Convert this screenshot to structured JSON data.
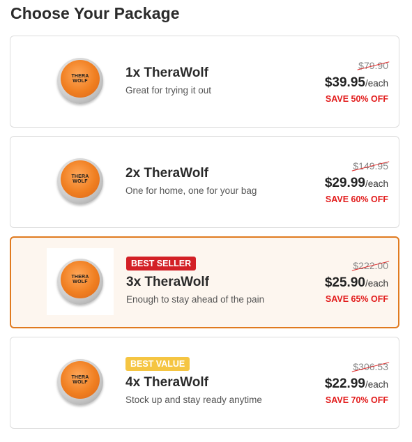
{
  "page": {
    "title": "Choose Your Package"
  },
  "product_image": {
    "brand_line1": "THERA",
    "brand_line2": "WOLF"
  },
  "colors": {
    "accent_border": "#e07a1f",
    "selected_bg": "#fdf6ef",
    "save_red": "#e21b1b",
    "badge_red": "#d32026",
    "badge_yellow": "#f5c542"
  },
  "packages": [
    {
      "name": "1x TheraWolf",
      "description": "Great for trying it out",
      "badge": "",
      "original_price": "$79.90",
      "price": "$39.95",
      "unit": "/each",
      "savings": "SAVE 50% OFF",
      "selected": false
    },
    {
      "name": "2x TheraWolf",
      "description": "One for home, one for your bag",
      "badge": "",
      "original_price": "$149.95",
      "price": "$29.99",
      "unit": "/each",
      "savings": "SAVE 60% OFF",
      "selected": false
    },
    {
      "name": "3x TheraWolf",
      "description": "Enough to stay ahead of the pain",
      "badge": "BEST SELLER",
      "original_price": "$222.00",
      "price": "$25.90",
      "unit": "/each",
      "savings": "SAVE 65% OFF",
      "selected": true
    },
    {
      "name": "4x TheraWolf",
      "description": "Stock up and stay ready anytime",
      "badge": "BEST VALUE",
      "original_price": "$306.53",
      "price": "$22.99",
      "unit": "/each",
      "savings": "SAVE 70% OFF",
      "selected": false
    }
  ]
}
